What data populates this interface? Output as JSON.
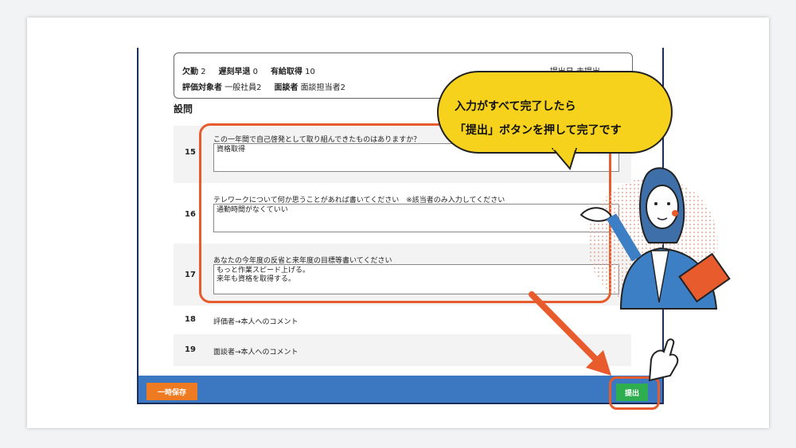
{
  "info": {
    "absence_label": "欠勤",
    "absence_value": "2",
    "late_label": "遅刻早退",
    "late_value": "0",
    "paid_leave_label": "有給取得",
    "paid_leave_value": "10",
    "submit_date": "提出日 未提出",
    "evaluatee_label": "評価対象者",
    "evaluatee_value": "一般社員2",
    "interviewer_label": "面談者",
    "interviewer_value": "面談担当者2"
  },
  "section_title": "設問",
  "questions": [
    {
      "num": "15",
      "text": "この一年間で自己啓発として取り組んできたものはありますか？",
      "answer": "資格取得"
    },
    {
      "num": "16",
      "text": "テレワークについて何か思うことがあれば書いてください　※該当者のみ入力してください",
      "answer": "通勤時間がなくていい"
    },
    {
      "num": "17",
      "text": "あなたの今年度の反省と来年度の目標等書いてください",
      "answer_line1": "もっと作業スピード上げる。",
      "answer_line2": "来年も資格を取得する。"
    },
    {
      "num": "18",
      "text": "評価者→本人へのコメント"
    },
    {
      "num": "19",
      "text": "面談者→本人へのコメント"
    }
  ],
  "footer": {
    "save_draft": "一時保存",
    "submit": "提出"
  },
  "callout": {
    "line1": "入力がすべて完了したら",
    "line2": "「提出」ボタンを押して完了です"
  },
  "colors": {
    "accent": "#e75b2c",
    "footer_bar": "#3c78c2",
    "submit_green": "#2fae50",
    "save_orange": "#ee7a22",
    "bubble_yellow": "#f6d21d"
  }
}
